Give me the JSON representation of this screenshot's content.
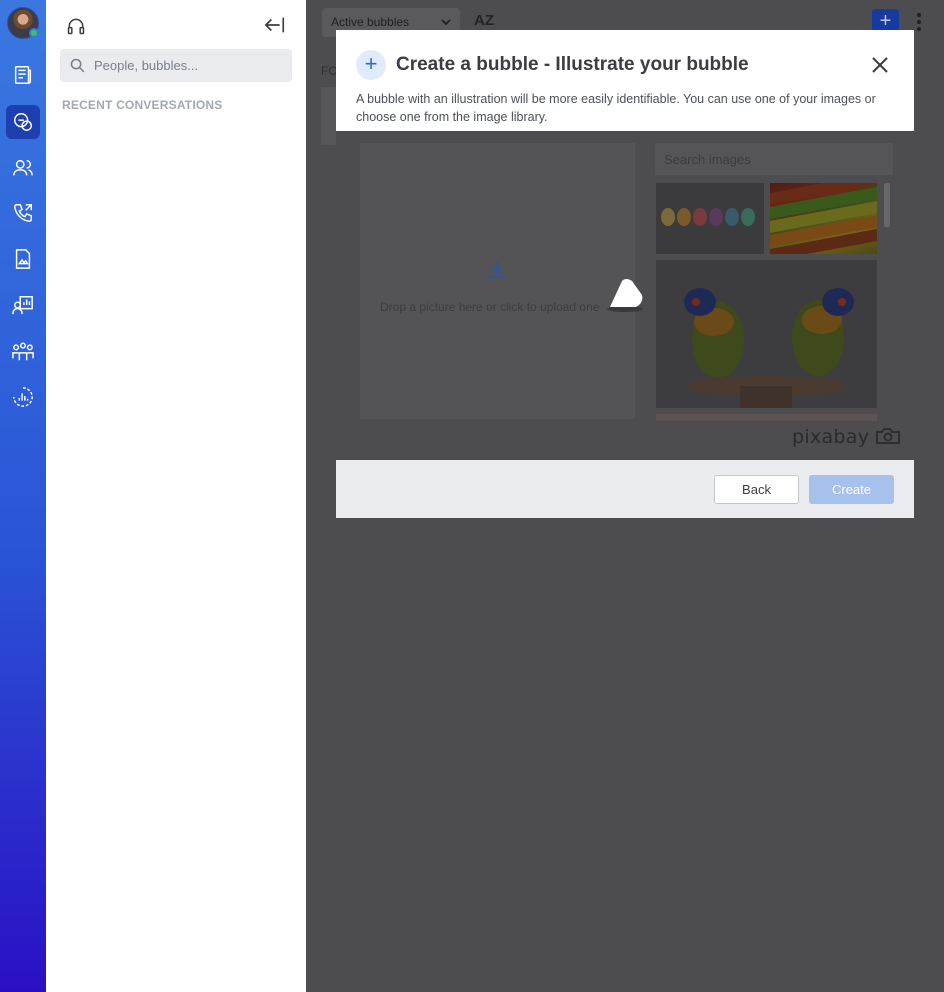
{
  "sidebar": {
    "items": [
      {
        "icon": "news-feed-icon"
      },
      {
        "icon": "bubbles-icon",
        "active": true
      },
      {
        "icon": "contacts-icon"
      },
      {
        "icon": "phone-icon"
      },
      {
        "icon": "files-icon"
      },
      {
        "icon": "meeting-icon"
      },
      {
        "icon": "groups-icon"
      },
      {
        "icon": "analytics-icon"
      }
    ],
    "presence_color": "#3ec25a",
    "accent": "#3a78e0"
  },
  "panel": {
    "search_placeholder": "People, bubbles...",
    "recent_label": "RECENT CONVERSATIONS"
  },
  "main": {
    "filter_label": "Active bubbles",
    "sort_label": "AZ",
    "section_label": "FO"
  },
  "modal": {
    "title": "Create a bubble - Illustrate your bubble",
    "description": "A bubble with an illustration will be more easily identifiable. You can use one of your images or choose one from the image library.",
    "drop_text": "Drop a picture here or click to upload one",
    "image_search_placeholder": "Search images",
    "library_brand": "pixabay",
    "back_label": "Back",
    "create_label": "Create",
    "create_color": "#a8c1ec"
  }
}
